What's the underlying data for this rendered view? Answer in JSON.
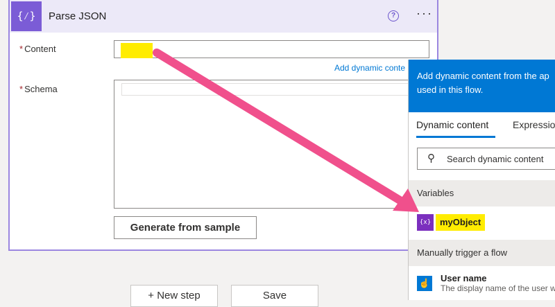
{
  "card": {
    "icon_glyph": "{⁄}",
    "title": "Parse JSON",
    "help_glyph": "?",
    "more_glyph": "···",
    "content_label": "Content",
    "schema_label": "Schema",
    "required_mark": "*",
    "add_dynamic_link": "Add dynamic conte",
    "generate_button": "Generate from sample"
  },
  "bottom": {
    "new_step": "+ New step",
    "save": "Save"
  },
  "panel": {
    "banner_line1": "Add dynamic content from the ap",
    "banner_line2": "used in this flow.",
    "tab_dynamic": "Dynamic content",
    "tab_expression": "Expressio",
    "search_placeholder": "Search dynamic content",
    "section_variables": "Variables",
    "var_icon_glyph": "{x}",
    "variable_name": "myObject",
    "section_manual": "Manually trigger a flow",
    "user_icon_glyph": "☝",
    "user_name_title": "User name",
    "user_name_desc": "The display name of the user w"
  },
  "colors": {
    "accent_purple": "#7b5cd6",
    "highlight_yellow": "#ffec00",
    "banner_blue": "#0078d4",
    "arrow_pink": "#f0508c"
  }
}
